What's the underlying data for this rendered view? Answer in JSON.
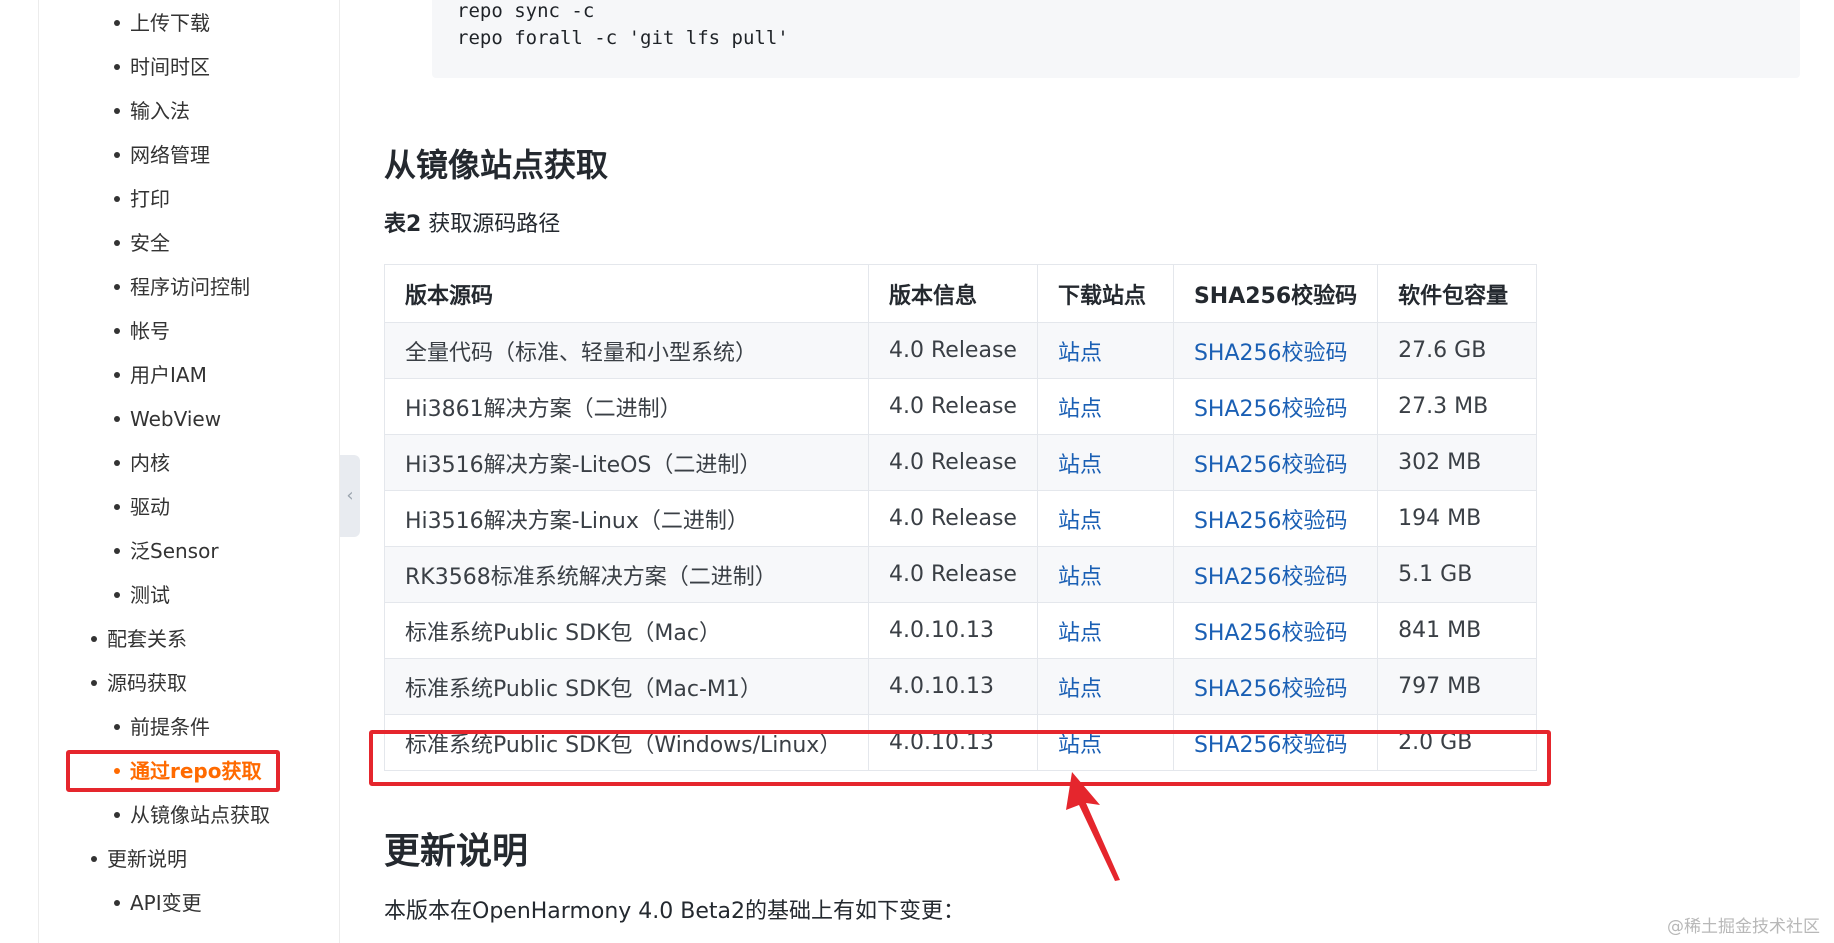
{
  "sidebar": {
    "items": [
      {
        "label": "上传下载",
        "level": 2
      },
      {
        "label": "时间时区",
        "level": 2
      },
      {
        "label": "输入法",
        "level": 2
      },
      {
        "label": "网络管理",
        "level": 2
      },
      {
        "label": "打印",
        "level": 2
      },
      {
        "label": "安全",
        "level": 2
      },
      {
        "label": "程序访问控制",
        "level": 2
      },
      {
        "label": "帐号",
        "level": 2
      },
      {
        "label": "用户IAM",
        "level": 2
      },
      {
        "label": "WebView",
        "level": 2
      },
      {
        "label": "内核",
        "level": 2
      },
      {
        "label": "驱动",
        "level": 2
      },
      {
        "label": "泛Sensor",
        "level": 2
      },
      {
        "label": "测试",
        "level": 2
      },
      {
        "label": "配套关系",
        "level": 1
      },
      {
        "label": "源码获取",
        "level": 1
      },
      {
        "label": "前提条件",
        "level": 2
      },
      {
        "label": "通过repo获取",
        "level": 2,
        "active": true
      },
      {
        "label": "从镜像站点获取",
        "level": 2
      },
      {
        "label": "更新说明",
        "level": 1
      },
      {
        "label": "API变更",
        "level": 2
      }
    ],
    "collapse_glyph": "‹",
    "active_color": "#ff6a00"
  },
  "code": {
    "lines": [
      "repo sync -c",
      "repo forall -c 'git lfs pull'"
    ]
  },
  "section_mirror": {
    "title": "从镜像站点获取",
    "caption_bold": "表2",
    "caption_text": " 获取源码路径"
  },
  "table": {
    "headers": [
      "版本源码",
      "版本信息",
      "下载站点",
      "SHA256校验码",
      "软件包容量"
    ],
    "rows": [
      [
        "全量代码（标准、轻量和小型系统）",
        "4.0 Release",
        "站点",
        "SHA256校验码",
        "27.6 GB"
      ],
      [
        "Hi3861解决方案（二进制）",
        "4.0 Release",
        "站点",
        "SHA256校验码",
        "27.3 MB"
      ],
      [
        "Hi3516解决方案-LiteOS（二进制）",
        "4.0 Release",
        "站点",
        "SHA256校验码",
        "302 MB"
      ],
      [
        "Hi3516解决方案-Linux（二进制）",
        "4.0 Release",
        "站点",
        "SHA256校验码",
        "194 MB"
      ],
      [
        "RK3568标准系统解决方案（二进制）",
        "4.0 Release",
        "站点",
        "SHA256校验码",
        "5.1 GB"
      ],
      [
        "标准系统Public SDK包（Mac）",
        "4.0.10.13",
        "站点",
        "SHA256校验码",
        "841 MB"
      ],
      [
        "标准系统Public SDK包（Mac-M1）",
        "4.0.10.13",
        "站点",
        "SHA256校验码",
        "797 MB"
      ],
      [
        "标准系统Public SDK包（Windows/Linux）",
        "4.0.10.13",
        "站点",
        "SHA256校验码",
        "2.0 GB"
      ]
    ],
    "link_color": "#1a5fb4",
    "highlight_color": "#e5262d"
  },
  "section_update": {
    "title": "更新说明",
    "intro": "本版本在OpenHarmony 4.0 Beta2的基础上有如下变更："
  },
  "watermark": "@稀土掘金技术社区"
}
